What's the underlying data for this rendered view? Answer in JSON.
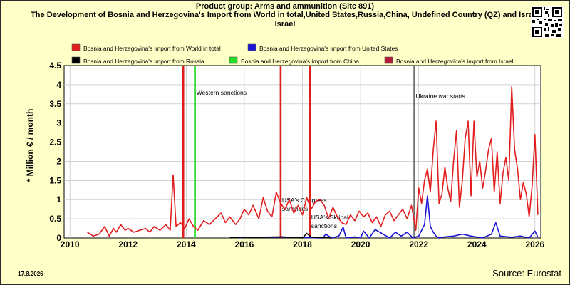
{
  "footer": {
    "date": "17.8.2026",
    "source": "Source: Eurostat"
  },
  "colors": {
    "background": "#ffffc8",
    "plot_bg": "#ffffff",
    "grid": "#b8b8b8",
    "world": "#e21e1e",
    "us": "#1b12d8",
    "russia": "#000000",
    "china": "#25dc25",
    "israel": "#b01e3c",
    "event_red": "#e01e1e",
    "event_green": "#20d820",
    "event_gray": "#707070"
  },
  "icons": {
    "qr": "qr-code-icon"
  },
  "chart_data": {
    "type": "line",
    "title": "Product group: Arms and ammunition (Sitc 891)",
    "subtitle": "The Development of Bosnia and Herzegovina's Import from World in total,United States,Russia,China, Undefined Country (QZ) and Israel",
    "subtitle_tail": "Israel",
    "ylabel": "* Million € / month",
    "xlabel": "",
    "xlim": [
      2009.8,
      2026.2
    ],
    "ylim": [
      0,
      4.5
    ],
    "x_ticks": [
      "2010",
      "2012",
      "2014",
      "2016",
      "2018",
      "2020",
      "2022",
      "2024",
      "2026"
    ],
    "y_ticks": [
      "0",
      "0.5",
      "1",
      "1.5",
      "2",
      "2.5",
      "3",
      "3.5",
      "4",
      "4.5"
    ],
    "grid": true,
    "legend_placement": "top",
    "legend": [
      "Bosnia and Herzegovina's import from World in total",
      "Bosnia and Herzegovina's import from United States",
      "Bosnia and Herzegovina's import from Russia",
      "Bosnia and Herzegovina's import from China",
      "Bosnia and Herzegovina's import from Israel"
    ],
    "events": [
      {
        "x": 2013.9,
        "color": "red"
      },
      {
        "x": 2014.3,
        "color": "green",
        "label": "Western sanctions"
      },
      {
        "x": 2017.25,
        "color": "red",
        "label": "USA's Congress"
      },
      {
        "x": 2017.25,
        "color": "red",
        "label": "sanctions"
      },
      {
        "x": 2018.25,
        "color": "red",
        "label": "USA's Skripal"
      },
      {
        "x": 2018.25,
        "color": "red",
        "label": "sanctions"
      },
      {
        "x": 2021.85,
        "color": "gray",
        "label": "Ukraine war starts"
      }
    ],
    "series": [
      {
        "name": "Bosnia and Herzegovina's import from World in total",
        "key": "world",
        "x": [
          2010.6,
          2010.8,
          2011.0,
          2011.2,
          2011.35,
          2011.5,
          2011.6,
          2011.75,
          2011.9,
          2012.0,
          2012.2,
          2012.4,
          2012.6,
          2012.75,
          2012.9,
          2013.1,
          2013.3,
          2013.45,
          2013.55,
          2013.65,
          2013.8,
          2013.95,
          2014.1,
          2014.25,
          2014.4,
          2014.6,
          2014.8,
          2015.0,
          2015.2,
          2015.35,
          2015.5,
          2015.7,
          2015.85,
          2016.0,
          2016.15,
          2016.3,
          2016.5,
          2016.65,
          2016.8,
          2016.95,
          2017.1,
          2017.25,
          2017.4,
          2017.55,
          2017.7,
          2017.85,
          2018.0,
          2018.15,
          2018.3,
          2018.45,
          2018.6,
          2018.75,
          2018.9,
          2019.05,
          2019.2,
          2019.35,
          2019.5,
          2019.65,
          2019.8,
          2019.95,
          2020.1,
          2020.25,
          2020.4,
          2020.55,
          2020.7,
          2020.85,
          2021.0,
          2021.15,
          2021.3,
          2021.45,
          2021.6,
          2021.75,
          2021.9,
          2022.0,
          2022.1,
          2022.2,
          2022.3,
          2022.4,
          2022.5,
          2022.6,
          2022.7,
          2022.8,
          2022.9,
          2023.0,
          2023.1,
          2023.2,
          2023.3,
          2023.4,
          2023.5,
          2023.6,
          2023.7,
          2023.8,
          2023.9,
          2024.0,
          2024.1,
          2024.2,
          2024.3,
          2024.4,
          2024.5,
          2024.6,
          2024.7,
          2024.8,
          2024.9,
          2025.0,
          2025.1,
          2025.2,
          2025.3,
          2025.4,
          2025.5,
          2025.6,
          2025.7,
          2025.8,
          2025.9,
          2026.0,
          2026.1
        ],
        "values": [
          0.15,
          0.05,
          0.1,
          0.3,
          0.05,
          0.25,
          0.15,
          0.35,
          0.2,
          0.25,
          0.15,
          0.2,
          0.25,
          0.15,
          0.3,
          0.2,
          0.35,
          0.2,
          1.65,
          0.3,
          0.4,
          0.25,
          0.5,
          0.3,
          0.2,
          0.45,
          0.35,
          0.5,
          0.65,
          0.4,
          0.55,
          0.35,
          0.5,
          0.75,
          0.6,
          0.85,
          0.5,
          1.05,
          0.7,
          0.55,
          1.2,
          0.9,
          0.75,
          1.0,
          0.65,
          0.85,
          0.6,
          1.05,
          0.75,
          0.95,
          1.0,
          0.85,
          0.5,
          0.8,
          0.55,
          0.4,
          0.35,
          0.6,
          0.45,
          0.7,
          0.55,
          0.65,
          0.4,
          0.55,
          0.3,
          0.6,
          0.7,
          0.45,
          0.6,
          0.75,
          0.5,
          0.85,
          0.2,
          1.3,
          0.9,
          1.5,
          1.8,
          1.2,
          2.3,
          3.05,
          0.9,
          1.15,
          1.85,
          1.3,
          0.95,
          2.0,
          2.8,
          0.8,
          1.5,
          2.6,
          3.05,
          1.1,
          3.05,
          1.6,
          2.0,
          1.3,
          1.75,
          2.3,
          2.6,
          1.2,
          2.25,
          0.9,
          1.7,
          2.1,
          1.5,
          3.95,
          2.3,
          1.8,
          1.0,
          1.45,
          1.15,
          0.55,
          1.35,
          2.7,
          0.6
        ],
        "style": "red"
      },
      {
        "name": "Bosnia and Herzegovina's import from United States",
        "key": "us",
        "x": [
          2015.8,
          2016.0,
          2017.5,
          2018.7,
          2018.8,
          2019.0,
          2019.25,
          2019.4,
          2019.5,
          2019.8,
          2020.0,
          2020.1,
          2020.3,
          2020.5,
          2021.0,
          2021.2,
          2021.4,
          2021.6,
          2021.8,
          2022.0,
          2022.2,
          2022.3,
          2022.4,
          2022.5,
          2022.6,
          2022.7,
          2022.9,
          2023.2,
          2023.5,
          2023.8,
          2024.2,
          2024.5,
          2024.65,
          2024.8,
          2025.2,
          2025.5,
          2025.8,
          2026.0,
          2026.1
        ],
        "values": [
          0.0,
          0.02,
          0.02,
          0.0,
          0.1,
          0.0,
          0.05,
          0.28,
          0.0,
          0.03,
          0.0,
          0.18,
          0.0,
          0.22,
          0.0,
          0.15,
          0.05,
          0.15,
          0.0,
          0.05,
          0.35,
          1.1,
          0.3,
          0.15,
          0.05,
          0.0,
          0.03,
          0.05,
          0.1,
          0.05,
          0.0,
          0.1,
          0.4,
          0.05,
          0.02,
          0.05,
          0.0,
          0.18,
          0.02
        ],
        "style": "blue"
      },
      {
        "name": "Bosnia and Herzegovina's import from Russia",
        "key": "russia",
        "x": [
          2015.5,
          2016.5,
          2017.3,
          2018.0,
          2018.15,
          2018.3,
          2019.0
        ],
        "values": [
          0.02,
          0.02,
          0.03,
          0.0,
          0.12,
          0.02,
          0.0
        ],
        "style": "black"
      }
    ]
  }
}
